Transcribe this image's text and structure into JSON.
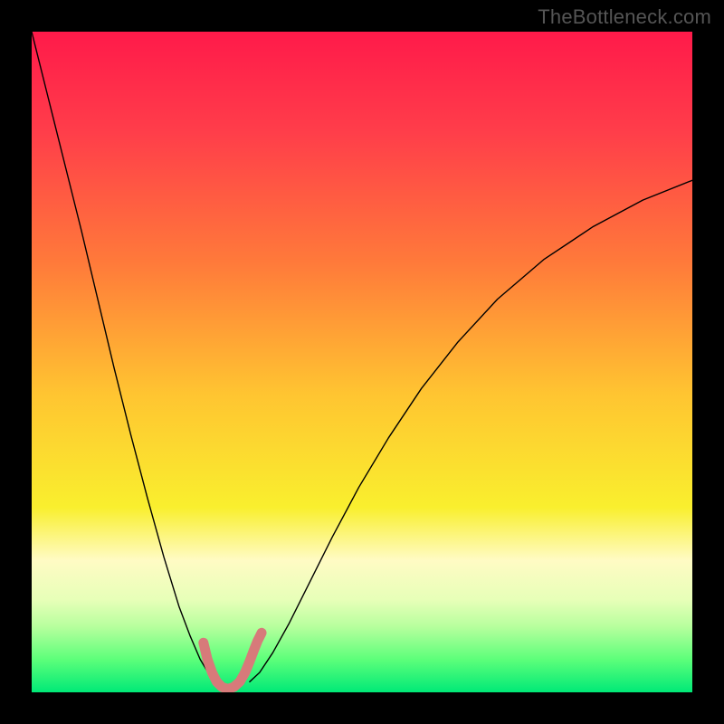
{
  "watermark": "TheBottleneck.com",
  "chart_data": {
    "type": "line",
    "title": "",
    "xlabel": "",
    "ylabel": "",
    "xlim": [
      0,
      100
    ],
    "ylim": [
      0,
      100
    ],
    "background": {
      "type": "vertical_gradient",
      "stops": [
        {
          "offset": 0.0,
          "color": "#ff1a4a"
        },
        {
          "offset": 0.15,
          "color": "#ff3d4a"
        },
        {
          "offset": 0.35,
          "color": "#ff7a3a"
        },
        {
          "offset": 0.55,
          "color": "#ffc531"
        },
        {
          "offset": 0.72,
          "color": "#f9ef2e"
        },
        {
          "offset": 0.8,
          "color": "#fffbc4"
        },
        {
          "offset": 0.86,
          "color": "#e7ffb8"
        },
        {
          "offset": 0.9,
          "color": "#b8ff9e"
        },
        {
          "offset": 0.95,
          "color": "#5dff7a"
        },
        {
          "offset": 1.0,
          "color": "#00e977"
        }
      ]
    },
    "series": [
      {
        "name": "curve-left",
        "stroke": "#000000",
        "stroke_width": 1.4,
        "x": [
          0.0,
          2.5,
          5.0,
          7.5,
          10.0,
          12.5,
          15.0,
          17.5,
          20.0,
          22.3,
          24.0,
          25.5,
          27.0,
          28.0
        ],
        "y": [
          100.0,
          90.0,
          80.0,
          70.0,
          59.5,
          49.0,
          39.0,
          29.5,
          20.5,
          13.0,
          8.5,
          5.0,
          2.5,
          1.6
        ]
      },
      {
        "name": "curve-right",
        "stroke": "#000000",
        "stroke_width": 1.4,
        "x": [
          33.0,
          34.5,
          36.5,
          39.0,
          42.0,
          45.5,
          49.5,
          54.0,
          59.0,
          64.5,
          70.5,
          77.5,
          85.0,
          92.5,
          100.0
        ],
        "y": [
          1.6,
          3.0,
          6.0,
          10.5,
          16.5,
          23.5,
          31.0,
          38.5,
          46.0,
          53.0,
          59.5,
          65.5,
          70.5,
          74.5,
          77.5
        ]
      },
      {
        "name": "highlight-band",
        "stroke": "#d77a7a",
        "stroke_width": 11,
        "x": [
          26.0,
          26.6,
          27.3,
          28.0,
          28.8,
          29.7,
          30.6,
          31.5,
          32.3,
          33.0,
          33.6,
          34.2,
          34.8
        ],
        "y": [
          7.5,
          5.0,
          3.0,
          1.6,
          0.8,
          0.5,
          0.8,
          1.6,
          3.0,
          4.7,
          6.3,
          7.8,
          9.0
        ]
      }
    ]
  }
}
